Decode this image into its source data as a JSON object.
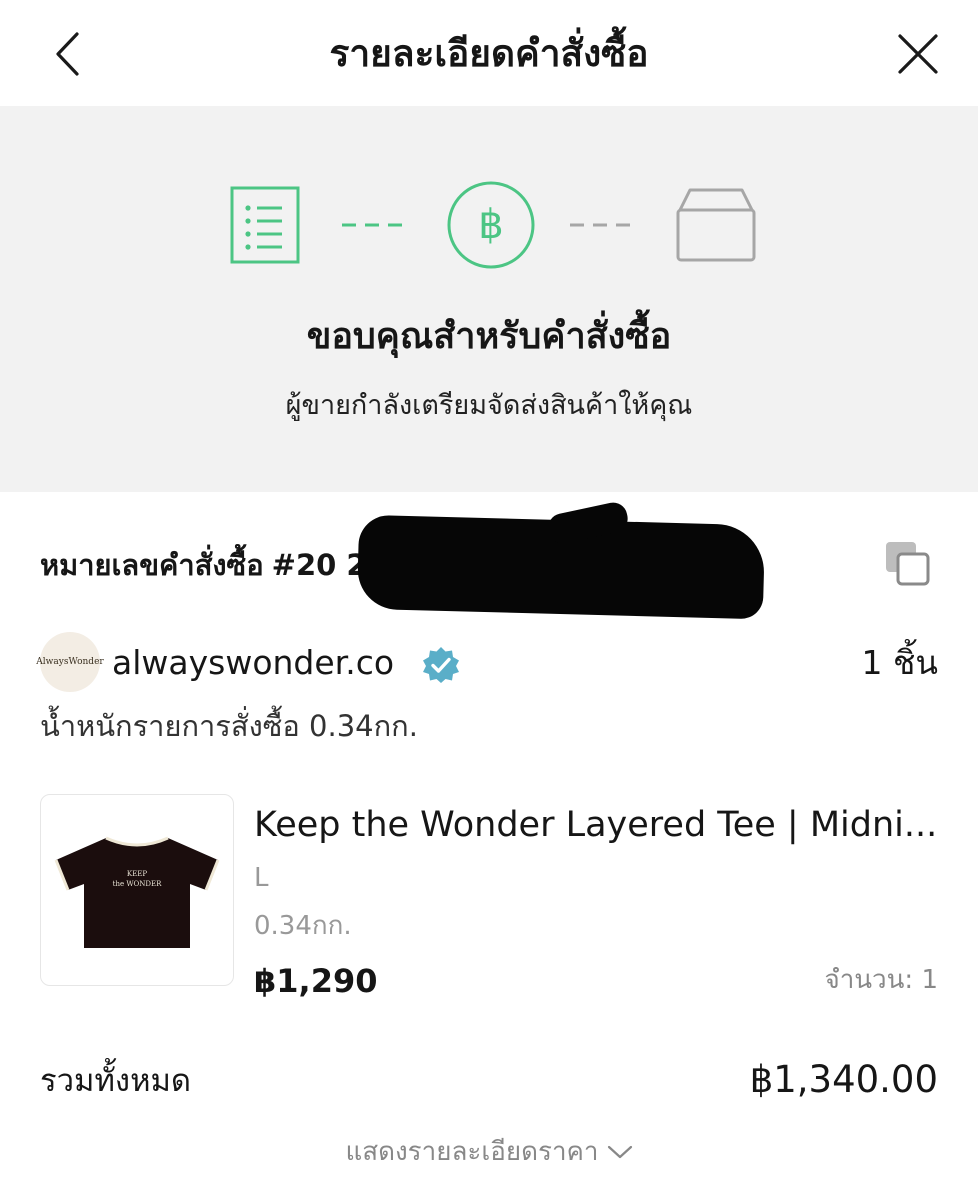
{
  "header": {
    "title": "รายละเอียดคำสั่งซื้อ"
  },
  "status": {
    "steps": [
      {
        "icon": "order-list-icon",
        "state": "done"
      },
      {
        "icon": "baht-payment-icon",
        "state": "done"
      },
      {
        "icon": "shipping-box-icon",
        "state": "pending"
      }
    ],
    "heading": "ขอบคุณสำหรับคำสั่งซื้อ",
    "message": "ผู้ขายกำลังเตรียมจัดส่งสินค้าให้คุณ",
    "accent_color": "#4cc584",
    "pending_color": "#a6a6a6"
  },
  "order": {
    "label": "หมายเลขคำสั่งซื้อ",
    "number_visible": "#20 249"
  },
  "shop": {
    "avatar_text": "AlwaysWonder",
    "name": "alwayswonder.co",
    "verified_color": "#5aaec8",
    "item_count": "1 ชิ้น",
    "weight_total": "น้ำหนักรายการสั่งซื้อ 0.34กก."
  },
  "item": {
    "name": "Keep the Wonder Layered Tee | Midni...",
    "variant": "L",
    "weight": "0.34กก.",
    "price": "฿1,290",
    "quantity": "จำนวน: 1",
    "image_text_1": "KEEP",
    "image_text_2": "the WONDER"
  },
  "summary": {
    "total_label": "รวมทั้งหมด",
    "total_value": "฿1,340.00",
    "show_details": "แสดงรายละเอียดราคา"
  }
}
